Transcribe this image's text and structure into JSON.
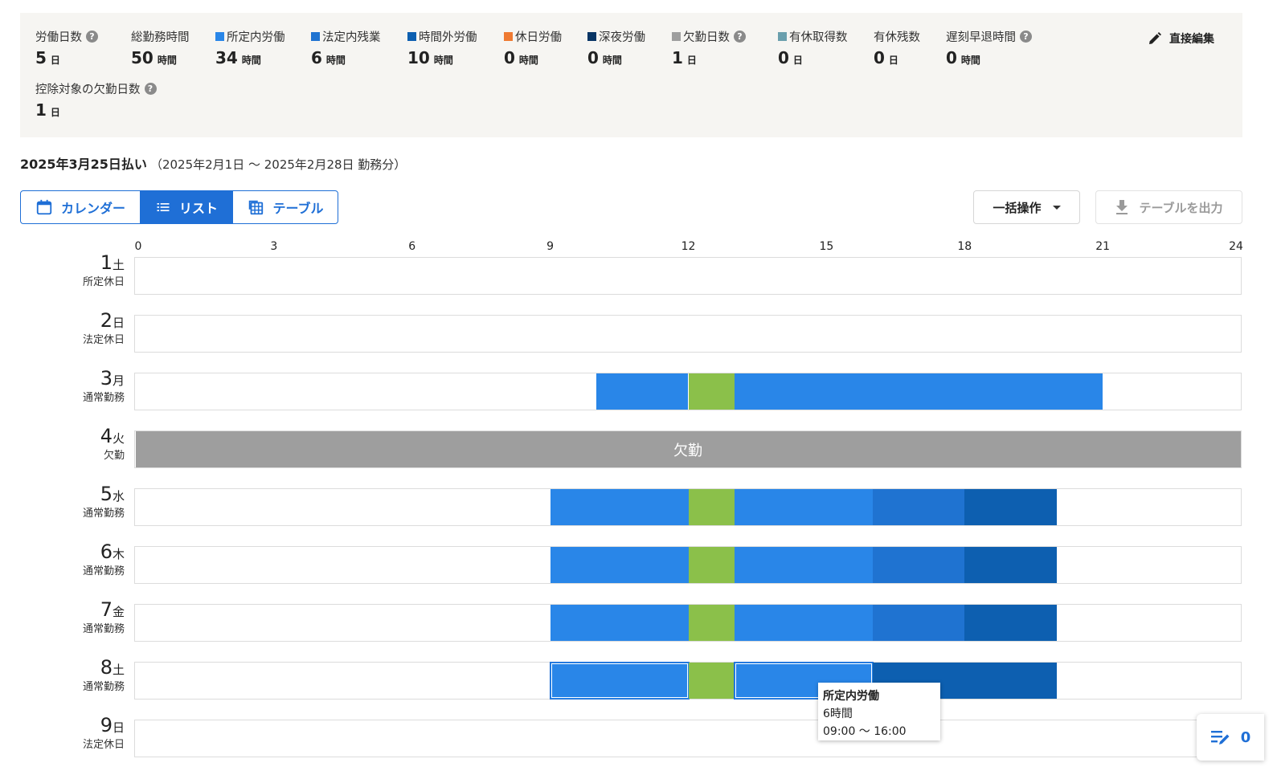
{
  "colors": {
    "scheduled": "#2986e8",
    "legal_overtime": "#1f73d1",
    "overtime": "#0d5fb0",
    "holiday_work": "#ef7a32",
    "night_work": "#083565",
    "absence": "#9e9e9e",
    "paid_leave": "#6a9fad",
    "break": "#8bc04a",
    "accent": "#1f6fd6"
  },
  "summary": {
    "stats": [
      {
        "label": "労働日数",
        "value": "5",
        "unit": "日",
        "help": true,
        "color": null
      },
      {
        "label": "総勤務時間",
        "value": "50",
        "unit": "時間",
        "help": false,
        "color": null
      },
      {
        "label": "所定内労働",
        "value": "34",
        "unit": "時間",
        "help": false,
        "color": "#2986e8"
      },
      {
        "label": "法定内残業",
        "value": "6",
        "unit": "時間",
        "help": false,
        "color": "#1f73d1"
      },
      {
        "label": "時間外労働",
        "value": "10",
        "unit": "時間",
        "help": false,
        "color": "#0d5fb0"
      },
      {
        "label": "休日労働",
        "value": "0",
        "unit": "時間",
        "help": false,
        "color": "#ef7a32"
      },
      {
        "label": "深夜労働",
        "value": "0",
        "unit": "時間",
        "help": false,
        "color": "#083565"
      },
      {
        "label": "欠勤日数",
        "value": "1",
        "unit": "日",
        "help": true,
        "color": "#9e9e9e"
      },
      {
        "label": "有休取得数",
        "value": "0",
        "unit": "日",
        "help": false,
        "color": "#6a9fad"
      },
      {
        "label": "有休残数",
        "value": "0",
        "unit": "日",
        "help": false,
        "color": null
      },
      {
        "label": "遅刻早退時間",
        "value": "0",
        "unit": "時間",
        "help": true,
        "color": null
      },
      {
        "label": "控除対象の欠勤日数",
        "value": "1",
        "unit": "日",
        "help": true,
        "color": null
      }
    ],
    "edit_label": "直接編集"
  },
  "period": {
    "pay_date": "2025年3月25日払い",
    "range": "（2025年2月1日 〜 2025年2月28日 勤務分）"
  },
  "view_toggle": {
    "calendar": "カレンダー",
    "list": "リスト",
    "table": "テーブル",
    "active": "list"
  },
  "actions": {
    "bulk": "一括操作",
    "export": "テーブルを出力"
  },
  "timeline": {
    "axis_start": 0,
    "axis_end": 24,
    "ticks": [
      "0",
      "3",
      "6",
      "9",
      "12",
      "15",
      "18",
      "21",
      "24"
    ],
    "days": [
      {
        "day": "1",
        "weekday": "土",
        "type": "所定休日",
        "segments": []
      },
      {
        "day": "2",
        "weekday": "日",
        "type": "法定休日",
        "segments": []
      },
      {
        "day": "3",
        "weekday": "月",
        "type": "通常勤務",
        "segments": [
          {
            "start": 10,
            "end": 12,
            "kind": "scheduled"
          },
          {
            "start": 12,
            "end": 13,
            "kind": "break"
          },
          {
            "start": 13,
            "end": 21,
            "kind": "scheduled"
          }
        ]
      },
      {
        "day": "4",
        "weekday": "火",
        "type": "欠勤",
        "absence_label": "欠勤",
        "segments": [
          {
            "start": 0,
            "end": 24,
            "kind": "absence"
          }
        ]
      },
      {
        "day": "5",
        "weekday": "水",
        "type": "通常勤務",
        "segments": [
          {
            "start": 9,
            "end": 12,
            "kind": "scheduled"
          },
          {
            "start": 12,
            "end": 13,
            "kind": "break"
          },
          {
            "start": 13,
            "end": 16,
            "kind": "scheduled"
          },
          {
            "start": 16,
            "end": 18,
            "kind": "legal_overtime"
          },
          {
            "start": 18,
            "end": 20,
            "kind": "overtime"
          }
        ]
      },
      {
        "day": "6",
        "weekday": "木",
        "type": "通常勤務",
        "segments": [
          {
            "start": 9,
            "end": 12,
            "kind": "scheduled"
          },
          {
            "start": 12,
            "end": 13,
            "kind": "break"
          },
          {
            "start": 13,
            "end": 16,
            "kind": "scheduled"
          },
          {
            "start": 16,
            "end": 18,
            "kind": "legal_overtime"
          },
          {
            "start": 18,
            "end": 20,
            "kind": "overtime"
          }
        ]
      },
      {
        "day": "7",
        "weekday": "金",
        "type": "通常勤務",
        "segments": [
          {
            "start": 9,
            "end": 12,
            "kind": "scheduled"
          },
          {
            "start": 12,
            "end": 13,
            "kind": "break"
          },
          {
            "start": 13,
            "end": 16,
            "kind": "scheduled"
          },
          {
            "start": 16,
            "end": 18,
            "kind": "legal_overtime"
          },
          {
            "start": 18,
            "end": 20,
            "kind": "overtime"
          }
        ]
      },
      {
        "day": "8",
        "weekday": "土",
        "type": "通常勤務",
        "segments": [
          {
            "start": 9,
            "end": 12,
            "kind": "scheduled",
            "highlight": true
          },
          {
            "start": 12,
            "end": 13,
            "kind": "break"
          },
          {
            "start": 13,
            "end": 16,
            "kind": "scheduled",
            "highlight": true
          },
          {
            "start": 16,
            "end": 20,
            "kind": "overtime"
          }
        ]
      },
      {
        "day": "9",
        "weekday": "日",
        "type": "法定休日",
        "segments": []
      }
    ]
  },
  "tooltip": {
    "title": "所定内労働",
    "duration": "6時間",
    "range": "09:00 〜 16:00"
  },
  "fab": {
    "count": "0"
  }
}
